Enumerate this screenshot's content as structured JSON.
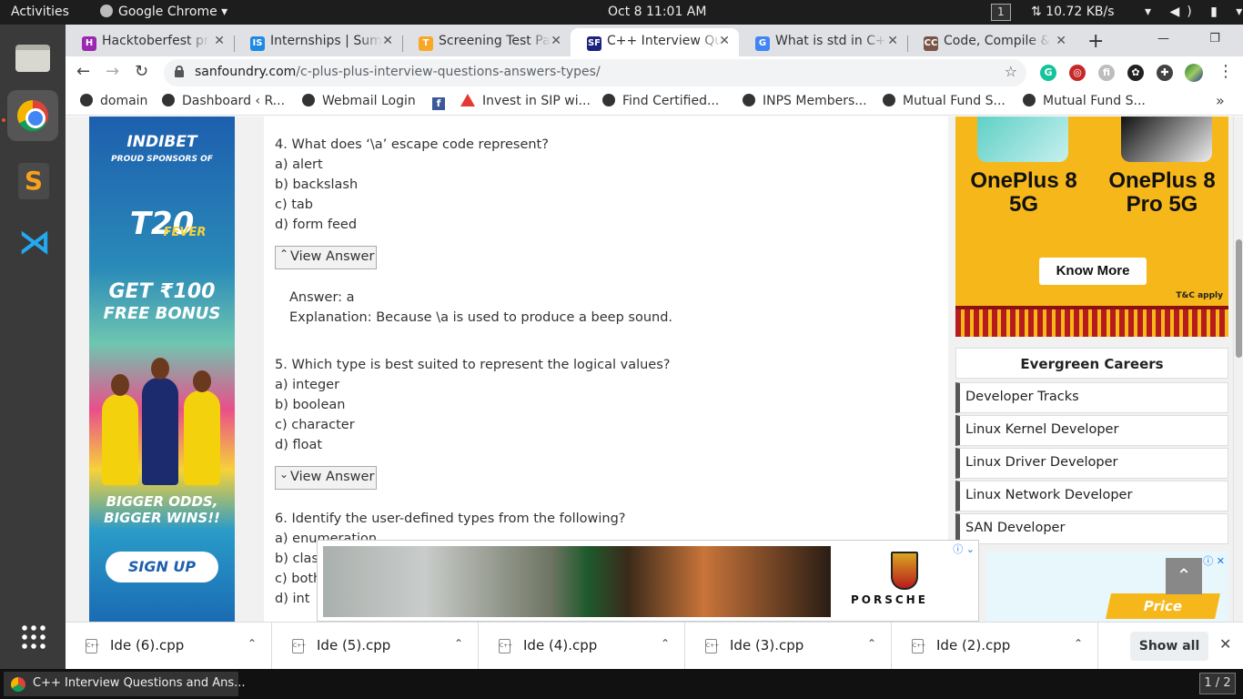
{
  "topbar": {
    "activities": "Activities",
    "app": "Google Chrome ▾",
    "clock": "Oct 8  11:01 AM",
    "workspace": "1",
    "net": "⇅ 10.72 KB/s",
    "system_icons": "▾ ◀) ▮ ▾"
  },
  "tabs": [
    {
      "label": "Hacktoberfest pr",
      "favicon": "H",
      "color": "#9c27b0"
    },
    {
      "label": "Internships | Sum",
      "favicon": "IS",
      "color": "#1e88e5"
    },
    {
      "label": "Screening Test Pa",
      "favicon": "T",
      "color": "#f9a825"
    },
    {
      "label": "C++ Interview Qu",
      "favicon": "SF",
      "color": "#1a237e"
    },
    {
      "label": "What is std in C+",
      "favicon": "G",
      "color": "#4285f4"
    },
    {
      "label": "Code, Compile & ",
      "favicon": "CC",
      "color": "#795548"
    }
  ],
  "tab_close": "✕",
  "newtab": "+",
  "window_controls": "— ❐ ✕",
  "toolbar": {
    "back": "←",
    "forward": "→",
    "reload": "↻",
    "url_host": "sanfoundry.com",
    "url_path": "/c-plus-plus-interview-questions-answers-types/",
    "star": "☆",
    "menu": "⋮"
  },
  "extensions": [
    {
      "label": "G",
      "color": "#15c39a"
    },
    {
      "label": "◎",
      "color": "#c62828"
    },
    {
      "label": "fi",
      "color": "#bdbdbd"
    },
    {
      "label": "✿",
      "color": "#212121"
    },
    {
      "label": "✚",
      "color": "#424242"
    }
  ],
  "bookmarks": [
    {
      "label": "domain",
      "icon": "globe"
    },
    {
      "label": "Dashboard ‹ R...",
      "icon": "globe"
    },
    {
      "label": "Webmail Login",
      "icon": "globe"
    },
    {
      "label": "f",
      "icon": "facebook"
    },
    {
      "label": "Invest in SIP wi...",
      "icon": "triangle"
    },
    {
      "label": "Find Certified...",
      "icon": "globe"
    },
    {
      "label": "INPS Members...",
      "icon": "globe"
    },
    {
      "label": "Mutual Fund S...",
      "icon": "globe"
    },
    {
      "label": "Mutual Fund S...",
      "icon": "globe"
    }
  ],
  "bookmarks_more": "»",
  "ad_left": {
    "brand": "INDIBET",
    "sponsor": "PROUD SPONSORS OF",
    "event": "T20",
    "event_sub": "FEVER",
    "bonus1": "GET ₹100",
    "bonus2": "FREE BONUS",
    "tag1": "BIGGER ODDS,",
    "tag2": "BIGGER WINS!!",
    "cta": "SIGN UP"
  },
  "article": {
    "q4": "4. What does ‘\\a’ escape code represent?",
    "q4_opts": [
      "a) alert",
      "b) backslash",
      "c) tab",
      "d) form feed"
    ],
    "view_answer": "View Answer",
    "q4_answer": "Answer: a",
    "q4_expl": "Explanation: Because \\a is used to produce a beep sound.",
    "q5": "5. Which type is best suited to represent the logical values?",
    "q5_opts": [
      "a) integer",
      "b) boolean",
      "c) character",
      "d) float"
    ],
    "q6": "6. Identify the user-defined types from the following?",
    "q6_opts": [
      "a) enumeration",
      "b) classes",
      "c) both a and b",
      "d) int"
    ]
  },
  "ad_oneplus": {
    "model1": "OnePlus 8 5G",
    "model2": "OnePlus 8 Pro 5G",
    "cta": "Know More",
    "tc": "T&C apply"
  },
  "careers": {
    "title": "Evergreen Careers",
    "items": [
      "Developer Tracks",
      "Linux Kernel Developer",
      "Linux Driver Developer",
      "Linux Network Developer",
      "SAN Developer"
    ]
  },
  "ad_price": {
    "label": "Price",
    "adchoices": "ⓘ ✕"
  },
  "ad_porsche": {
    "brand": "PORSCHE",
    "adchoices": "ⓘ ⌄"
  },
  "scroll_top": "⌃",
  "downloads": [
    "Ide (6).cpp",
    "Ide (5).cpp",
    "Ide (4).cpp",
    "Ide (3).cpp",
    "Ide (2).cpp"
  ],
  "show_all": "Show all",
  "shelf_close": "✕",
  "taskbar": {
    "window": "C++ Interview Questions and Ans...",
    "workspace": "1 / 2"
  }
}
